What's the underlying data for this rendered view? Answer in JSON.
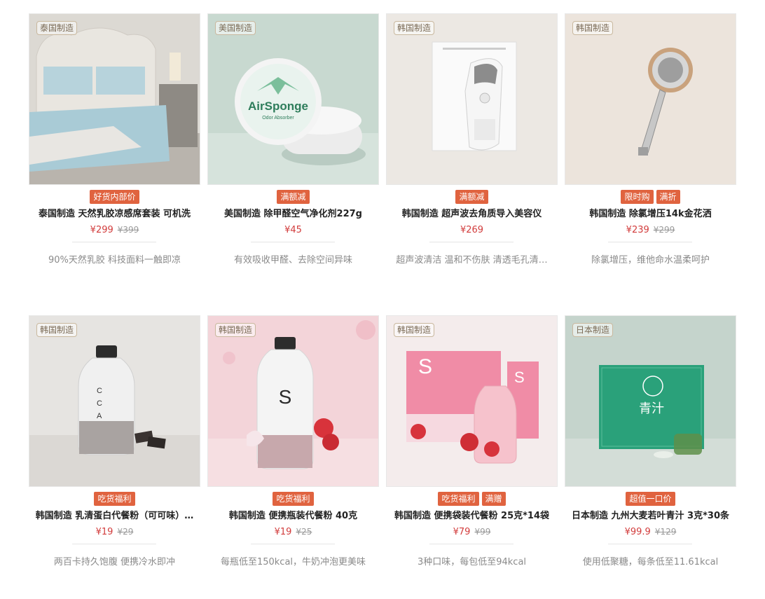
{
  "products": [
    {
      "origin": "泰国制造",
      "tags": [
        "好货内部价"
      ],
      "name": "泰国制造 天然乳胶凉感席套装 可机洗",
      "price": "¥299",
      "orig": "¥399",
      "desc": "90%天然乳胶 科技面料一触即凉",
      "image": "bed-latex-mat",
      "image_text": ""
    },
    {
      "origin": "美国制造",
      "tags": [
        "满额减"
      ],
      "name": "美国制造 除甲醛空气净化剂227g",
      "price": "¥45",
      "orig": "",
      "desc": "有效吸收甲醛、去除空间异味",
      "image": "airsponge-jar",
      "image_text": "AirSponge"
    },
    {
      "origin": "韩国制造",
      "tags": [
        "满额减"
      ],
      "name": "韩国制造 超声波去角质导入美容仪",
      "price": "¥269",
      "orig": "",
      "desc": "超声波清洁 温和不伤肤 清透毛孔清…",
      "image": "ultrasonic-device",
      "image_text": ""
    },
    {
      "origin": "韩国制造",
      "tags": [
        "限时购",
        "满折"
      ],
      "name": "韩国制造 除氯增压14k金花洒",
      "price": "¥239",
      "orig": "¥299",
      "desc": "除氯增压，维他命水温柔呵护",
      "image": "shower-head",
      "image_text": ""
    },
    {
      "origin": "韩国制造",
      "tags": [
        "吃货福利"
      ],
      "name": "韩国制造 乳清蛋白代餐粉（可可味）…",
      "price": "¥19",
      "orig": "¥29",
      "desc": "两百卡持久饱腹 便携冷水即冲",
      "image": "cca-bottle",
      "image_text": "CCA"
    },
    {
      "origin": "韩国制造",
      "tags": [
        "吃货福利"
      ],
      "name": "韩国制造 便携瓶装代餐粉 40克",
      "price": "¥19",
      "orig": "¥25",
      "desc": "每瓶低至150kcal，牛奶冲泡更美味",
      "image": "s-bottle-strawberry",
      "image_text": "S"
    },
    {
      "origin": "韩国制造",
      "tags": [
        "吃货福利",
        "满赠"
      ],
      "name": "韩国制造 便携袋装代餐粉 25克*14袋",
      "price": "¥79",
      "orig": "¥99",
      "desc": "3种口味，每包低至94kcal",
      "image": "s-box-pink",
      "image_text": "S"
    },
    {
      "origin": "日本制造",
      "tags": [
        "超值一口价"
      ],
      "name": "日本制造 九州大麦若叶青汁 3克*30条",
      "price": "¥99.9",
      "orig": "¥129",
      "desc": "使用低聚糖，每条低至11.61kcal",
      "image": "green-juice-box",
      "image_text": "青汁"
    }
  ],
  "colors": {
    "tag_bg": "#e0633f",
    "price": "#d23c3c"
  }
}
